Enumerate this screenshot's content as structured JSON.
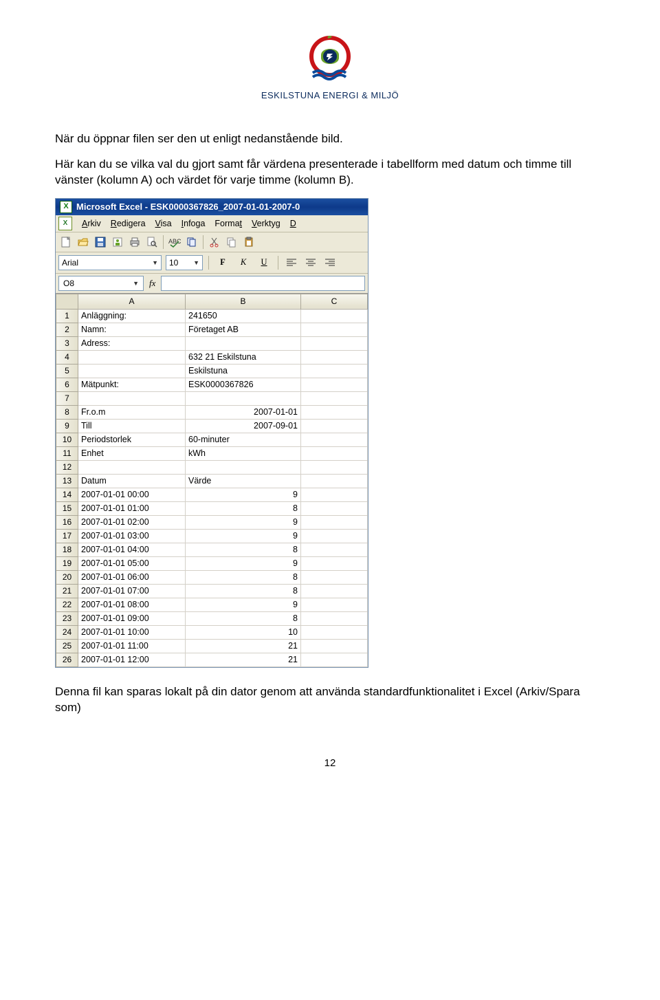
{
  "logo_text": "ESKILSTUNA ENERGI & MILJÖ",
  "para1": "När du öppnar filen ser den ut enligt nedanstående bild.",
  "para2": "Här kan du se vilka val du gjort samt får värdena presenterade i tabellform med datum och timme till vänster (kolumn A) och värdet för varje timme (kolumn B).",
  "excel": {
    "title": "Microsoft Excel - ESK0000367826_2007-01-01-2007-0",
    "menus": [
      "Arkiv",
      "Redigera",
      "Visa",
      "Infoga",
      "Format",
      "Verktyg",
      "D"
    ],
    "menu_underline_idx": [
      0,
      0,
      0,
      0,
      5,
      0,
      0
    ],
    "font_name": "Arial",
    "font_size": "10",
    "bold": "F",
    "italic": "K",
    "underline": "U",
    "namebox": "O8",
    "fx": "fx",
    "col_headers": [
      "A",
      "B",
      "C"
    ],
    "rows": [
      {
        "n": "1",
        "a": "Anläggning:",
        "b": "241650",
        "b_align": "left"
      },
      {
        "n": "2",
        "a": "Namn:",
        "b": "Företaget AB",
        "b_align": "left"
      },
      {
        "n": "3",
        "a": "Adress:",
        "b": "",
        "b_align": "left"
      },
      {
        "n": "4",
        "a": "",
        "b": "632 21 Eskilstuna",
        "b_align": "left"
      },
      {
        "n": "5",
        "a": "",
        "b": "Eskilstuna",
        "b_align": "left"
      },
      {
        "n": "6",
        "a": "Mätpunkt:",
        "b": "ESK0000367826",
        "b_align": "left"
      },
      {
        "n": "7",
        "a": "",
        "b": "",
        "b_align": "left"
      },
      {
        "n": "8",
        "a": "Fr.o.m",
        "b": "2007-01-01",
        "b_align": "right"
      },
      {
        "n": "9",
        "a": "Till",
        "b": "2007-09-01",
        "b_align": "right"
      },
      {
        "n": "10",
        "a": "Periodstorlek",
        "b": "60-minuter",
        "b_align": "left"
      },
      {
        "n": "11",
        "a": "Enhet",
        "b": "kWh",
        "b_align": "left"
      },
      {
        "n": "12",
        "a": "",
        "b": "",
        "b_align": "left"
      },
      {
        "n": "13",
        "a": "Datum",
        "b": "Värde",
        "b_align": "left"
      },
      {
        "n": "14",
        "a": "2007-01-01 00:00",
        "b": "9",
        "b_align": "right"
      },
      {
        "n": "15",
        "a": "2007-01-01 01:00",
        "b": "8",
        "b_align": "right"
      },
      {
        "n": "16",
        "a": "2007-01-01 02:00",
        "b": "9",
        "b_align": "right"
      },
      {
        "n": "17",
        "a": "2007-01-01 03:00",
        "b": "9",
        "b_align": "right"
      },
      {
        "n": "18",
        "a": "2007-01-01 04:00",
        "b": "8",
        "b_align": "right"
      },
      {
        "n": "19",
        "a": "2007-01-01 05:00",
        "b": "9",
        "b_align": "right"
      },
      {
        "n": "20",
        "a": "2007-01-01 06:00",
        "b": "8",
        "b_align": "right"
      },
      {
        "n": "21",
        "a": "2007-01-01 07:00",
        "b": "8",
        "b_align": "right"
      },
      {
        "n": "22",
        "a": "2007-01-01 08:00",
        "b": "9",
        "b_align": "right"
      },
      {
        "n": "23",
        "a": "2007-01-01 09:00",
        "b": "8",
        "b_align": "right"
      },
      {
        "n": "24",
        "a": "2007-01-01 10:00",
        "b": "10",
        "b_align": "right"
      },
      {
        "n": "25",
        "a": "2007-01-01 11:00",
        "b": "21",
        "b_align": "right"
      },
      {
        "n": "26",
        "a": "2007-01-01 12:00",
        "b": "21",
        "b_align": "right"
      }
    ]
  },
  "para3": "Denna fil kan sparas lokalt på din dator genom att använda standardfunktionalitet i Excel (Arkiv/Spara som)",
  "page_number": "12"
}
